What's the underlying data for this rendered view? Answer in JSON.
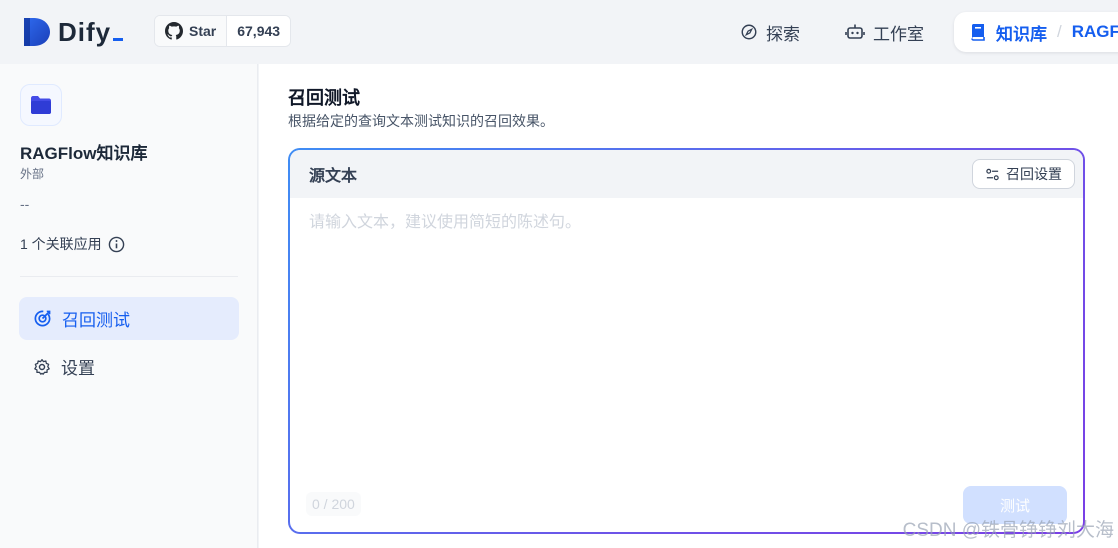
{
  "header": {
    "logo_text": "Dify",
    "github": {
      "label": "Star",
      "count": "67,943"
    },
    "nav": {
      "explore": "探索",
      "studio": "工作室",
      "knowledge": "知识库",
      "separator": "/",
      "current_dataset": "RAGF"
    }
  },
  "sidebar": {
    "dataset_name": "RAGFlow知识库",
    "dataset_type": "外部",
    "dataset_description": "--",
    "linked_apps": "1 个关联应用",
    "menu": [
      {
        "label": "召回测试",
        "icon": "target-icon",
        "active": true
      },
      {
        "label": "设置",
        "icon": "gear-icon",
        "active": false
      }
    ]
  },
  "main": {
    "title": "召回测试",
    "subtitle": "根据给定的查询文本测试知识的召回效果。",
    "source_box": {
      "title": "源文本",
      "settings_button": "召回设置",
      "placeholder": "请输入文本，建议使用简短的陈述句。",
      "counter": "0 / 200",
      "test_button": "测试"
    }
  },
  "watermark": "CSDN @铁骨铮铮刘大海",
  "colors": {
    "accent": "#155eef",
    "active_bg": "#e5ecfd",
    "gradient_start": "#3f8df4",
    "gradient_end": "#7a3fe6"
  }
}
